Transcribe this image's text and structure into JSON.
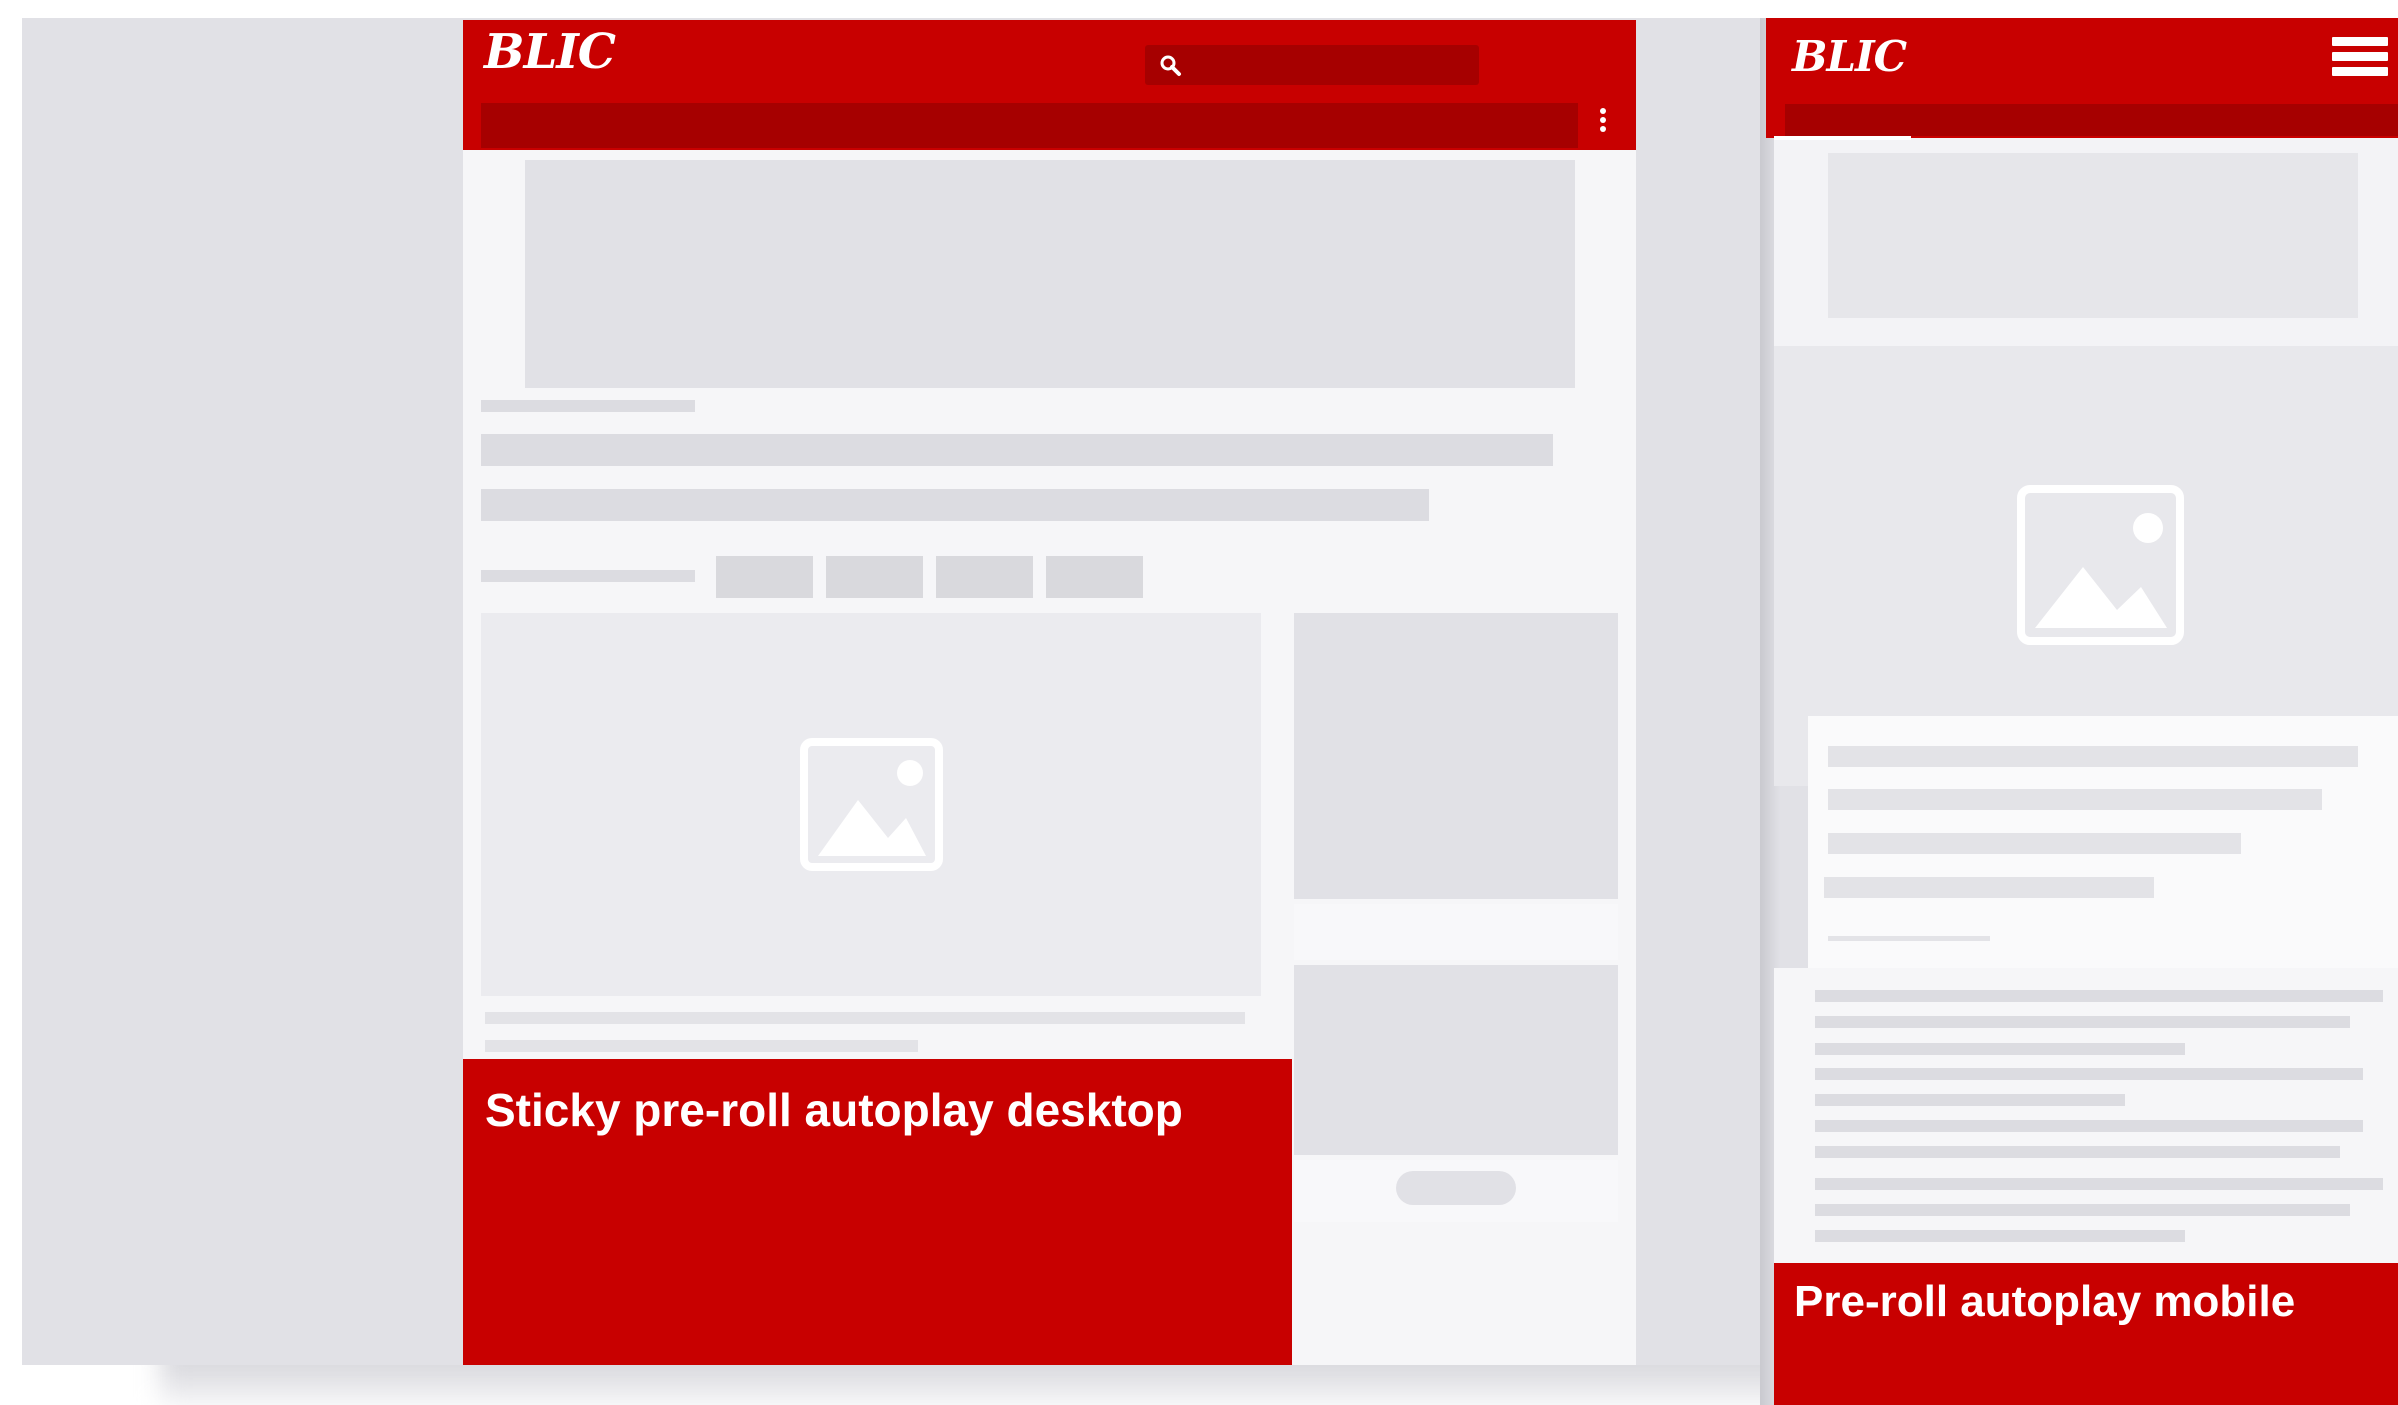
{
  "colors": {
    "brand_red": "#c80000",
    "brand_red_dark": "#a60000",
    "placeholder_gray": "#e1e1e6",
    "page_bg": "#f6f6f8"
  },
  "desktop": {
    "logo": "BLIC",
    "search_icon": "search-icon",
    "menu_icon": "kebab-menu-icon",
    "image_icon": "image-placeholder-icon",
    "ad_label": "Sticky pre-roll autoplay desktop"
  },
  "mobile": {
    "logo": "BLIC",
    "menu_icon": "hamburger-menu-icon",
    "image_icon": "image-placeholder-icon",
    "ad_label": "Pre-roll autoplay mobile"
  }
}
